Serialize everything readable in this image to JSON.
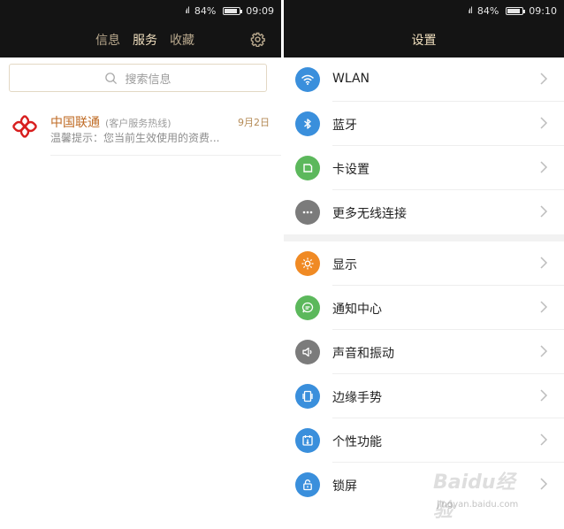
{
  "left": {
    "status": {
      "signal": "ᵢıl",
      "battery_pct": "84%",
      "time": "09:09",
      "battery_level": 0.84
    },
    "tabs": [
      {
        "label": "信息",
        "active": false
      },
      {
        "label": "服务",
        "active": true
      },
      {
        "label": "收藏",
        "active": false
      }
    ],
    "search": {
      "placeholder": "搜索信息"
    },
    "messages": [
      {
        "sender": "中国联通",
        "tag": "(客户服务热线)",
        "date": "9月2日",
        "preview": "温馨提示：您当前生效使用的资费..."
      }
    ]
  },
  "right": {
    "status": {
      "signal": "ᵢıl",
      "battery_pct": "84%",
      "time": "09:10",
      "battery_level": 0.84
    },
    "title": "设置",
    "groups": [
      [
        {
          "label": "WLAN",
          "icon": "wifi-icon",
          "color": "#3a8fdc"
        },
        {
          "label": "蓝牙",
          "icon": "bluetooth-icon",
          "color": "#3a8fdc"
        },
        {
          "label": "卡设置",
          "icon": "sim-card-icon",
          "color": "#5cb85c"
        },
        {
          "label": "更多无线连接",
          "icon": "more-icon",
          "color": "#7b7b7b"
        }
      ],
      [
        {
          "label": "显示",
          "icon": "brightness-icon",
          "color": "#f08a24"
        },
        {
          "label": "通知中心",
          "icon": "notification-icon",
          "color": "#5cb85c"
        },
        {
          "label": "声音和振动",
          "icon": "speaker-icon",
          "color": "#7b7b7b"
        },
        {
          "label": "边缘手势",
          "icon": "edge-gesture-icon",
          "color": "#3a8fdc"
        },
        {
          "label": "个性功能",
          "icon": "features-icon",
          "color": "#3a8fdc"
        },
        {
          "label": "锁屏",
          "icon": "lock-icon",
          "color": "#3a8fdc"
        }
      ]
    ]
  },
  "watermark": {
    "text": "Baidu经验",
    "sub": "jingyan.baidu.com"
  }
}
